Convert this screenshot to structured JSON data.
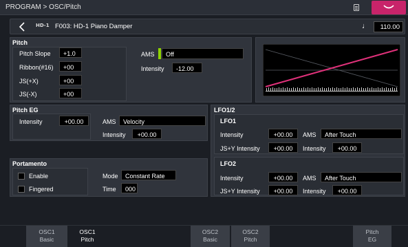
{
  "header": {
    "breadcrumb": "PROGRAM > OSC/Pitch",
    "page_icon": "page-list-icon",
    "menu_icon": "chevron-down-icon"
  },
  "program": {
    "back_icon": "chevron-left-icon",
    "bank_logo": "HD-1",
    "name": "F003: HD-1 Piano Damper",
    "tempo_icon": "quarter-note-icon",
    "tempo": "110.00"
  },
  "pitch": {
    "title": "Pitch",
    "pitch_slope_label": "Pitch Slope",
    "pitch_slope": "+1.0",
    "ribbon_label": "Ribbon(#16)",
    "ribbon": "+00",
    "js_plus_x_label": "JS(+X)",
    "js_plus_x": "+00",
    "js_minus_x_label": "JS(-X)",
    "js_minus_x": "+00",
    "ams_label": "AMS",
    "ams_value": "Off",
    "intensity_label": "Intensity",
    "intensity": "-12.00"
  },
  "pitch_eg": {
    "title": "Pitch EG",
    "intensity_label": "Intensity",
    "intensity": "+00.00",
    "ams_label": "AMS",
    "ams_value": "Velocity",
    "ams_intensity_label": "Intensity",
    "ams_intensity": "+00.00"
  },
  "portamento": {
    "title": "Portamento",
    "enable_label": "Enable",
    "enable_checked": false,
    "fingered_label": "Fingered",
    "fingered_checked": false,
    "mode_label": "Mode",
    "mode_value": "Constant Rate",
    "time_label": "Time",
    "time_value": "000"
  },
  "lfo": {
    "title": "LFO1/2",
    "lfo1": {
      "title": "LFO1",
      "intensity_label": "Intensity",
      "intensity": "+00.00",
      "jsy_label": "JS+Y Intensity",
      "jsy": "+00.00",
      "ams_label": "AMS",
      "ams_value": "After Touch",
      "ams_intensity_label": "Intensity",
      "ams_intensity": "+00.00"
    },
    "lfo2": {
      "title": "LFO2",
      "intensity_label": "Intensity",
      "intensity": "+00.00",
      "jsy_label": "JS+Y Intensity",
      "jsy": "+00.00",
      "ams_label": "AMS",
      "ams_value": "After Touch",
      "ams_intensity_label": "Intensity",
      "ams_intensity": "+00.00"
    }
  },
  "tabs": [
    {
      "line1": "OSC1",
      "line2": "Basic",
      "active": false
    },
    {
      "line1": "OSC1",
      "line2": "Pitch",
      "active": true
    },
    {
      "line1": "OSC2",
      "line2": "Basic",
      "active": false
    },
    {
      "line1": "OSC2",
      "line2": "Pitch",
      "active": false
    },
    {
      "line1": "Pitch",
      "line2": "EG",
      "active": false
    }
  ],
  "colors": {
    "accent": "#c8246a",
    "ams_indicator": "#8fd400",
    "slope_line": "#e0317a"
  }
}
